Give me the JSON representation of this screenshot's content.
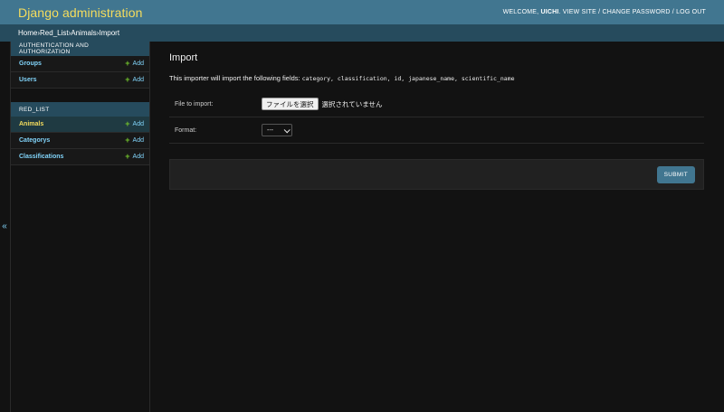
{
  "header": {
    "branding": "Django administration",
    "welcome_label": "WELCOME,",
    "username": "UICHI",
    "view_site": "VIEW SITE",
    "change_password": "CHANGE PASSWORD",
    "log_out": "LOG OUT",
    "separator": " / "
  },
  "breadcrumbs": {
    "items": [
      "Home",
      "Red_List",
      "Animals",
      "Import"
    ],
    "separator": " › "
  },
  "sidebar": {
    "modules": [
      {
        "caption": "AUTHENTICATION AND AUTHORIZATION",
        "models": [
          {
            "name": "Groups",
            "add": "Add"
          },
          {
            "name": "Users",
            "add": "Add"
          }
        ]
      },
      {
        "caption": "RED_LIST",
        "models": [
          {
            "name": "Animals",
            "add": "Add"
          },
          {
            "name": "Categorys",
            "add": "Add"
          },
          {
            "name": "Classifications",
            "add": "Add"
          }
        ]
      }
    ],
    "toggle_label": "«"
  },
  "main": {
    "title": "Import",
    "importer_prefix": "This importer will import the following fields:",
    "fields": "category, classification, id, japanese_name, scientific_name",
    "file_label": "File to import:",
    "file_button": "ファイルを選択",
    "file_status": "選択されていません",
    "format_label": "Format:",
    "format_value": "---",
    "submit_label": "SUBMIT"
  },
  "colors": {
    "header_bg": "#417690",
    "branding": "#f5dd5d",
    "breadcrumbs_bg": "#264b5d",
    "link": "#81d4fa",
    "add_icon": "#70bf2b",
    "body_bg": "#121212"
  }
}
